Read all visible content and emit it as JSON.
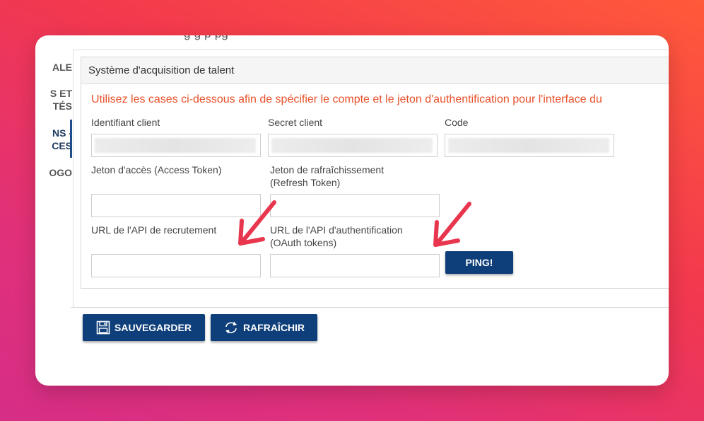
{
  "top_cut_text": "g  g  p  pg",
  "sidebar": {
    "items": [
      {
        "label": "ALE"
      },
      {
        "label": "S ET\nTÉS"
      },
      {
        "label": "NS -\nCES"
      },
      {
        "label": "OGO"
      }
    ],
    "active_index": 2
  },
  "panel": {
    "title": "Système d'acquisition de talent",
    "info": "Utilisez les cases ci-dessous afin de spécifier le compte et le jeton d'authentification pour l'interface du"
  },
  "fields": {
    "client_id": {
      "label": "Identifiant client",
      "value": ""
    },
    "client_secret": {
      "label": "Secret client",
      "value": ""
    },
    "code": {
      "label": "Code",
      "value": ""
    },
    "access_token": {
      "label": "Jeton d'accès (Access Token)",
      "value": ""
    },
    "refresh_token": {
      "label": "Jeton de rafraîchissement\n(Refresh Token)",
      "value": ""
    },
    "recruit_api_url": {
      "label": "URL de l'API de recrutement",
      "value": ""
    },
    "auth_api_url": {
      "label": "URL de l'API d'authentification\n(OAuth tokens)",
      "value": ""
    }
  },
  "buttons": {
    "ping": "PING!",
    "save": "SAUVEGARDER",
    "refresh": "RAFRAÎCHIR"
  },
  "colors": {
    "primary_button": "#0e3f7a",
    "info_text": "#e8512a",
    "annotation_arrow": "#e8364e"
  },
  "icons": {
    "save": "floppy-disk-icon",
    "refresh": "refresh-icon",
    "annotation": "arrow-icon"
  }
}
